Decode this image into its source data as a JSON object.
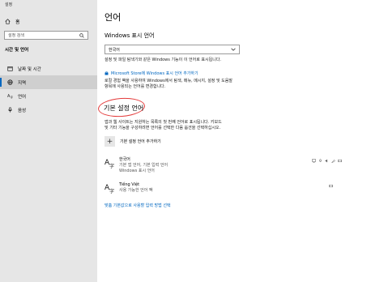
{
  "window": {
    "title": "설정"
  },
  "sidebar": {
    "home_label": "홈",
    "search_placeholder": "설정 검색",
    "section_title": "시간 및 언어",
    "items": [
      {
        "label": "날짜 및 시간",
        "icon": "calendar-clock-icon"
      },
      {
        "label": "지역",
        "icon": "globe-icon",
        "selected": true
      },
      {
        "label": "언어",
        "icon": "language-icon"
      },
      {
        "label": "음성",
        "icon": "microphone-icon"
      }
    ]
  },
  "main": {
    "title": "언어",
    "display_language": {
      "heading": "Windows 표시 언어",
      "selected": "한국어",
      "description_1": "설정 및 파일 탐색기와 같은 Windows 기능이 이 언어로 표시됩니다.",
      "store_link": "Microsoft Store에 Windows 표시 언어 추가하기",
      "description_2a": "로컬 경험 팩을 사용하여 Windows에서 탐색, 메뉴, 메시지, 설정 및 도움말",
      "description_2b": "항목에 사용되는 언어를 변경합니다."
    },
    "preferred": {
      "heading": "기본 설정 언어",
      "description_1": "앱과 웹 사이트는 지원하는 목록의 첫 번째 언어로 표시됩니다. 키보드",
      "description_2": "및 기타 기능을 구성하려면 언어를 선택한 다음 옵션을 선택하십시오.",
      "add_label": "기본 설정 언어 추가하기",
      "languages": [
        {
          "name": "한국어",
          "line2": "기본 앱 언어, 기본 입력 언어",
          "line3": "Windows 표시 언어"
        },
        {
          "name": "Tiếng Việt",
          "line2": "사용 가능한 언어 팩",
          "line3": ""
        }
      ]
    },
    "footer_link": "맞춤 기본값으로 사용할 입력 방법 선택"
  },
  "colors": {
    "accent": "#0067c0",
    "annotation": "#e43b3b",
    "sidebar_bg": "#e6e6e6"
  }
}
